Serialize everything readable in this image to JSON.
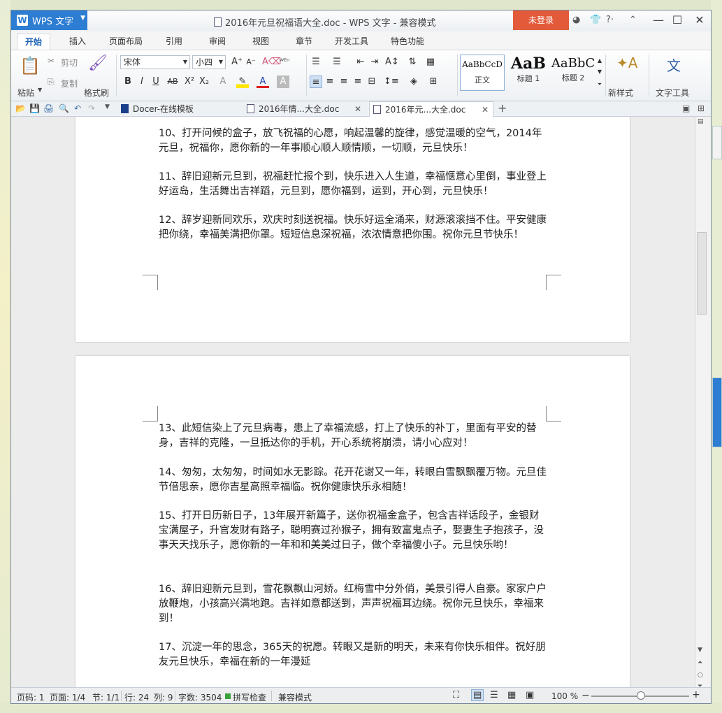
{
  "window": {
    "app_name": "WPS 文字",
    "title": "2016年元旦祝福语大全.doc - WPS 文字 - 兼容模式",
    "login_button": "未登录"
  },
  "ribbon_tabs": [
    "开始",
    "插入",
    "页面布局",
    "引用",
    "审阅",
    "视图",
    "章节",
    "开发工具",
    "特色功能"
  ],
  "ribbon": {
    "paste": "粘贴",
    "cut": "剪切",
    "copy": "复制",
    "format_painter": "格式刷",
    "font_name": "宋体",
    "font_size": "小四",
    "styles": [
      {
        "sample": "AaBbCcD",
        "label": "正文"
      },
      {
        "sample": "AaB",
        "label": "标题 1"
      },
      {
        "sample": "AaBbC",
        "label": "标题 2"
      }
    ],
    "new_style": "新样式",
    "text_tools": "文字工具"
  },
  "doc_tabs": [
    {
      "label": "Docer-在线模板"
    },
    {
      "label": "2016年情...大全.doc"
    },
    {
      "label": "2016年元...大全.doc"
    }
  ],
  "page1_paragraphs": [
    "10、打开问候的盒子，放飞祝福的心愿，响起温馨的旋律，感觉温暖的空气，2014年元旦，祝福你，愿你新的一年事顺心顺人顺情顺，一切顺，元旦快乐！",
    "11、辞旧迎新元旦到，祝福赶忙报个到，快乐进入人生道，幸福惬意心里倒，事业登上好运岛，生活舞出吉祥蹈，元旦到，愿你福到，运到，开心到，元旦快乐！",
    "12、辞岁迎新同欢乐，欢庆时刻送祝福。快乐好运全涌来，财源滚滚挡不住。平安健康把你绕，幸福美满把你罩。短短信息深祝福，浓浓情意把你围。祝你元旦节快乐！"
  ],
  "page2_paragraphs": [
    "13、此短信染上了元旦病毒，患上了幸福流感，打上了快乐的补丁，里面有平安的替身，吉祥的克隆，一旦抵达你的手机，开心系统将崩溃，请小心应对！",
    "14、匆匆，太匆匆，时间如水无影踪。花开花谢又一年，转眼白雪飘飘覆万物。元旦佳节倍思亲，愿你吉星高照幸福临。祝你健康快乐永相随！",
    "15、打开日历新日子，13年展开新篇子，送你祝福金盒子，包含吉祥话段子，金银财宝满屋子，升官发财有路子，聪明赛过孙猴子，拥有致富鬼点子，娶妻生子抱孩子，没事天天找乐子，愿你新的一年和和美美过日子，做个幸福傻小子。元旦快乐哟！",
    "16、辞旧迎新元旦到，雪花飘飘山河娇。红梅雪中分外俏，美景引得人自豪。家家户户放鞭炮，小孩高兴满地跑。吉祥如意都送到，声声祝福耳边绕。祝你元旦快乐，幸福来到！",
    "17、沉淀一年的思念，365天的祝愿。转眼又是新的明天，未来有你快乐相伴。祝好朋友元旦快乐，幸福在新的一年漫延"
  ],
  "status": {
    "page_code": "页码: 1",
    "pages": "页面: 1/4",
    "section": "节: 1/1",
    "row": "行: 24",
    "col": "列: 9",
    "word_count": "字数: 3504",
    "spell_check": "拼写检查",
    "compat_mode": "兼容模式",
    "zoom": "100 %"
  },
  "colors": {
    "accent": "#2d7dd2",
    "login": "#e35a3a",
    "page_bg": "#ffffff"
  }
}
